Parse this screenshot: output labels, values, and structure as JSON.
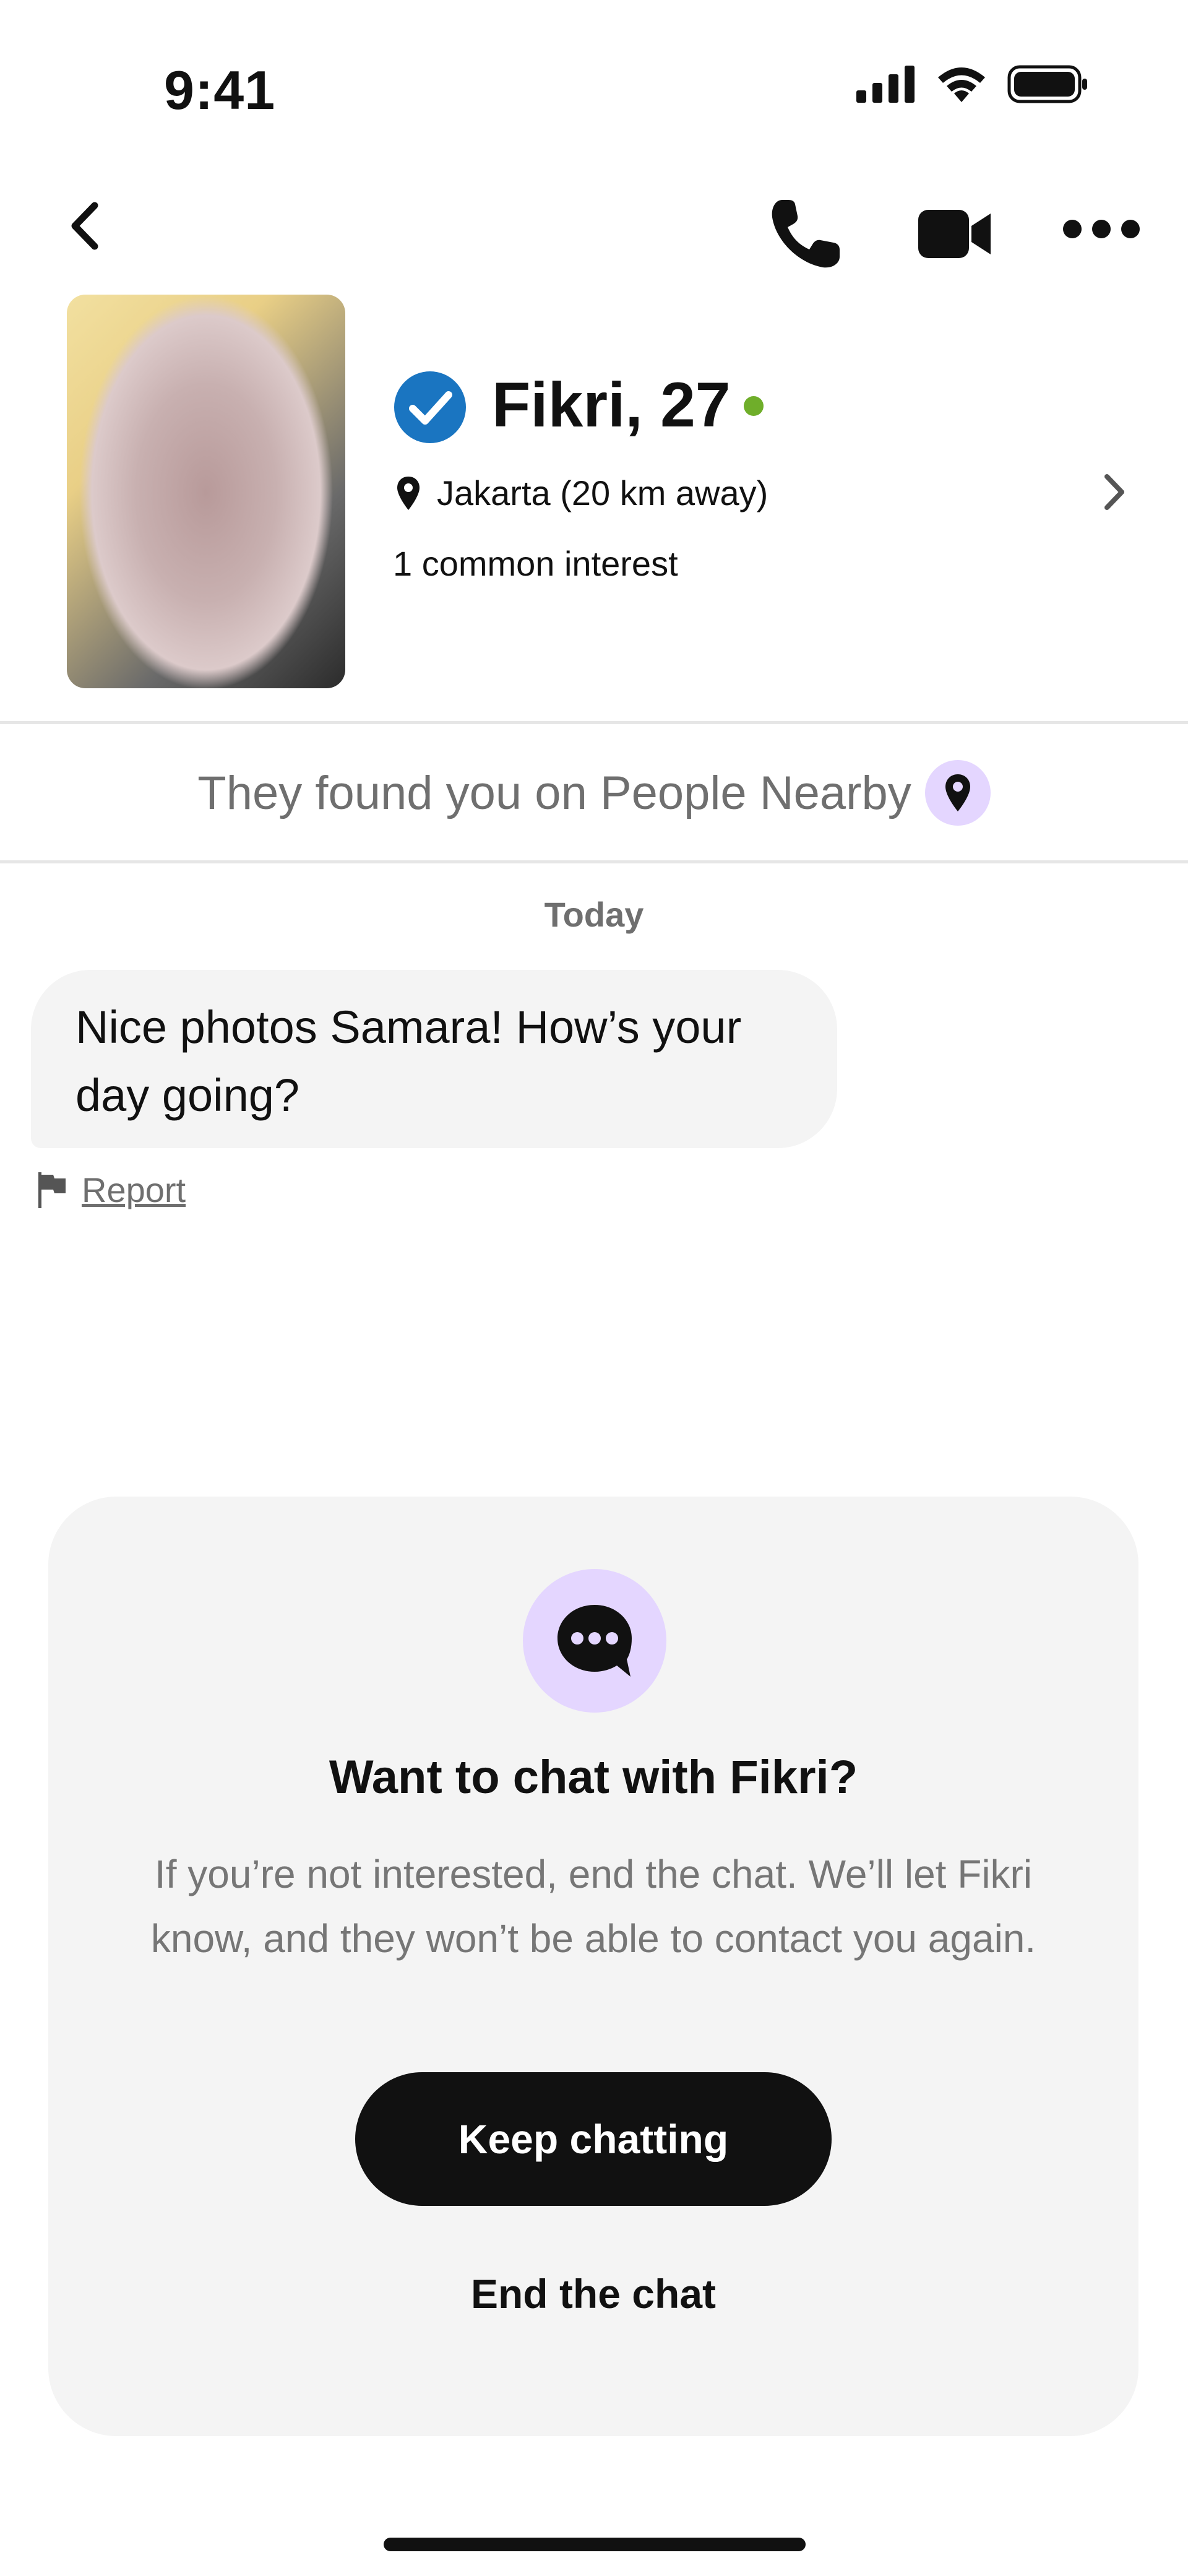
{
  "status_bar": {
    "time": "9:41"
  },
  "nav": {
    "back_icon": "chevron-left-icon",
    "call_icon": "phone-icon",
    "video_icon": "video-camera-icon",
    "more_icon": "more-horizontal-icon"
  },
  "profile": {
    "name_age": "Fikri, 27",
    "verified": true,
    "online": true,
    "location": "Jakarta (20 km away)",
    "common_interests": "1 common interest"
  },
  "banner": {
    "text": "They found you on People Nearby"
  },
  "chat": {
    "date_label": "Today",
    "messages": [
      {
        "text": "Nice photos Samara! How’s your day going?",
        "from": "them"
      }
    ],
    "report_label": "Report"
  },
  "prompt_card": {
    "title": "Want to chat with Fikri?",
    "description": "If you’re not interested, end the chat. We’ll let Fikri know, and they won’t be able to contact you again.",
    "primary_label": "Keep chatting",
    "secondary_label": "End the chat"
  },
  "colors": {
    "accent_purple_light": "#e4d6ff",
    "verified_blue": "#1a75c1",
    "online_green": "#6fae2a",
    "button_dark": "#111111",
    "card_bg": "#f4f4f4"
  }
}
